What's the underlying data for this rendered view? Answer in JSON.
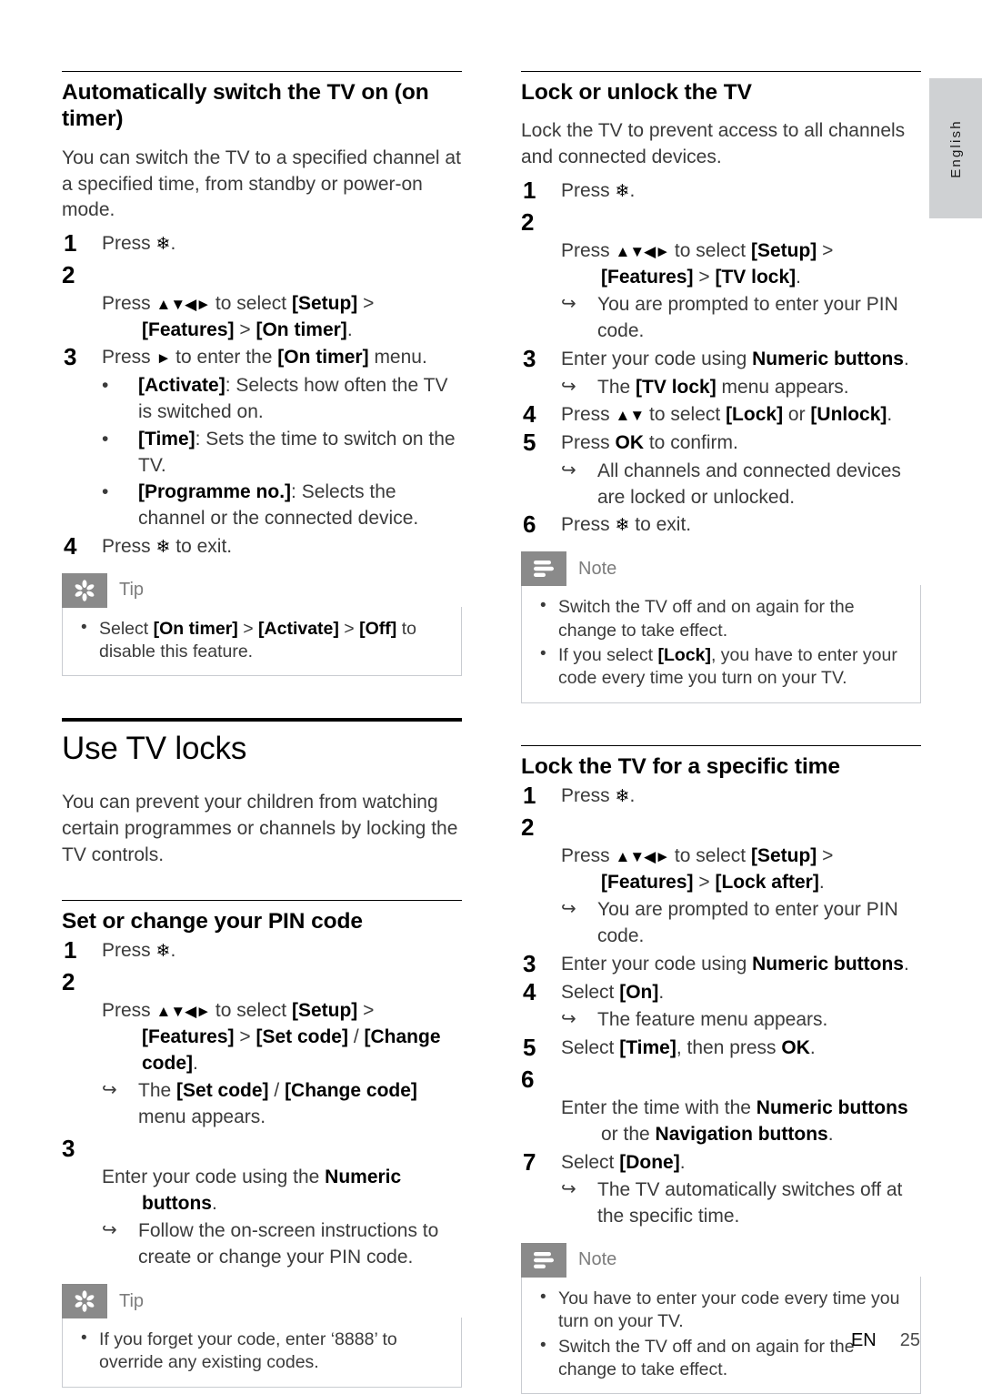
{
  "page": {
    "language_tab": "English",
    "footer_lang": "EN",
    "footer_page": "25"
  },
  "icons": {
    "tip": "asterisk-icon",
    "note": "lines-icon",
    "home": "home-icon",
    "nav": "navigation-arrows-icon",
    "arrow_right": "right-arrow-icon",
    "result_arrow": "result-arrow-icon",
    "bullet": "bullet-dot-icon"
  },
  "glyphs": {
    "home": "⌂",
    "nav4": "▲▼◄►",
    "nav2": "▲▼",
    "right": "►",
    "result": "↪",
    "bullet": "•",
    "gt": ">"
  },
  "colors": {
    "callout_icon_bg": "#8a8a8a",
    "callout_border": "#c9ccd1",
    "callout_title": "#7d7d7d",
    "lang_tab_bg": "#cfd1d3",
    "body_text": "#3b3b3b",
    "heading_text": "#000000"
  },
  "left_column": {
    "section_on_timer": {
      "heading": "Automatically switch the TV on (on timer)",
      "intro": "You can switch the TV to a specified channel at a specified time, from standby or power-on mode.",
      "steps": [
        {
          "num": "1",
          "pre": "Press ",
          "glyph": "home",
          "post": "."
        },
        {
          "num": "2",
          "pre": "Press ",
          "glyph": "nav4",
          "post": " to select [Setup] > [Features] > [On timer].",
          "bold_parts": [
            "[Setup]",
            "[Features]",
            "[On timer]"
          ]
        },
        {
          "num": "3",
          "pre": "Press ",
          "glyph": "right",
          "post": " to enter the [On timer] menu.",
          "bold_parts": [
            "[On timer]"
          ]
        },
        {
          "num": "4",
          "pre": "Press ",
          "glyph": "home",
          "post": " to exit."
        }
      ],
      "step3_bullets": [
        {
          "term": "[Activate]",
          "desc": ": Selects how often the TV is switched on."
        },
        {
          "term": "[Time]",
          "desc": ": Sets the time to switch on the TV."
        },
        {
          "term": "[Programme no.]",
          "desc": ": Selects the channel or the connected device."
        }
      ],
      "tip": {
        "title": "Tip",
        "items": [
          {
            "plain_1": "Select ",
            "b1": "[On timer]",
            "mid1": " > ",
            "b2": "[Activate]",
            "mid2": " > ",
            "b3": "[Off]",
            "tail": " to disable this feature."
          }
        ]
      }
    },
    "chapter_tv_locks": {
      "heading": "Use TV locks",
      "intro": "You can prevent your children from watching certain programmes or channels by locking the TV controls."
    },
    "section_pin": {
      "heading": "Set or change your PIN code",
      "steps": [
        {
          "num": "1",
          "pre": "Press ",
          "glyph": "home",
          "post": "."
        },
        {
          "num": "2",
          "pre": "Press ",
          "glyph": "nav4",
          "post": " to select [Setup] > [Features] > [Set code] / [Change code]."
        },
        {
          "num": "3",
          "pre": "Enter your code using the Numeric buttons.",
          "glyph": "",
          "post": ""
        }
      ],
      "step2_result": "The [Set code] / [Change code] menu appears.",
      "step3_result": "Follow the on-screen instructions to create or change your PIN code.",
      "tip": {
        "title": "Tip",
        "items": [
          {
            "text": "If you forget your code, enter ‘8888’ to override any existing codes."
          }
        ]
      }
    }
  },
  "right_column": {
    "section_lock_unlock": {
      "heading": "Lock or unlock the TV",
      "intro": "Lock the TV to prevent access to all channels and connected devices.",
      "steps": [
        {
          "num": "1",
          "pre": "Press ",
          "glyph": "home",
          "post": "."
        },
        {
          "num": "2",
          "pre": "Press ",
          "glyph": "nav4",
          "post": " to select [Setup] > [Features] > [TV lock]."
        },
        {
          "num": "3",
          "pre": "Enter your code using Numeric buttons."
        },
        {
          "num": "4",
          "pre": "Press ",
          "glyph": "nav2",
          "post": " to select [Lock] or [Unlock]."
        },
        {
          "num": "5",
          "pre": "Press OK to confirm."
        },
        {
          "num": "6",
          "pre": "Press ",
          "glyph": "home",
          "post": " to exit."
        }
      ],
      "step2_result": "You are prompted to enter your PIN code.",
      "step3_result": "The [TV lock] menu appears.",
      "step5_result": "All channels and connected devices are locked or unlocked.",
      "note": {
        "title": "Note",
        "items": [
          {
            "text": "Switch the TV off and on again for the change to take effect."
          },
          {
            "pre": "If you select ",
            "b": "[Lock]",
            "post": ", you have to enter your code every time you turn on your TV."
          }
        ]
      }
    },
    "section_lock_time": {
      "heading": "Lock the TV for a specific time",
      "steps": [
        {
          "num": "1",
          "pre": "Press ",
          "glyph": "home",
          "post": "."
        },
        {
          "num": "2",
          "pre": "Press ",
          "glyph": "nav4",
          "post": " to select [Setup] > [Features] > [Lock after]."
        },
        {
          "num": "3",
          "pre": "Enter your code using Numeric buttons."
        },
        {
          "num": "4",
          "pre": "Select [On]."
        },
        {
          "num": "5",
          "pre": "Select [Time], then press OK."
        },
        {
          "num": "6",
          "pre": "Enter the time with the Numeric buttons or the Navigation buttons."
        },
        {
          "num": "7",
          "pre": "Select [Done]."
        }
      ],
      "step2_result": "You are prompted to enter your PIN code.",
      "step4_result": "The feature menu appears.",
      "step7_result": "The TV automatically switches off at the specific time.",
      "note": {
        "title": "Note",
        "items": [
          {
            "text": "You have to enter your code every time you turn on your TV."
          },
          {
            "text": "Switch the TV off and on again for the change to take effect."
          }
        ]
      }
    }
  }
}
